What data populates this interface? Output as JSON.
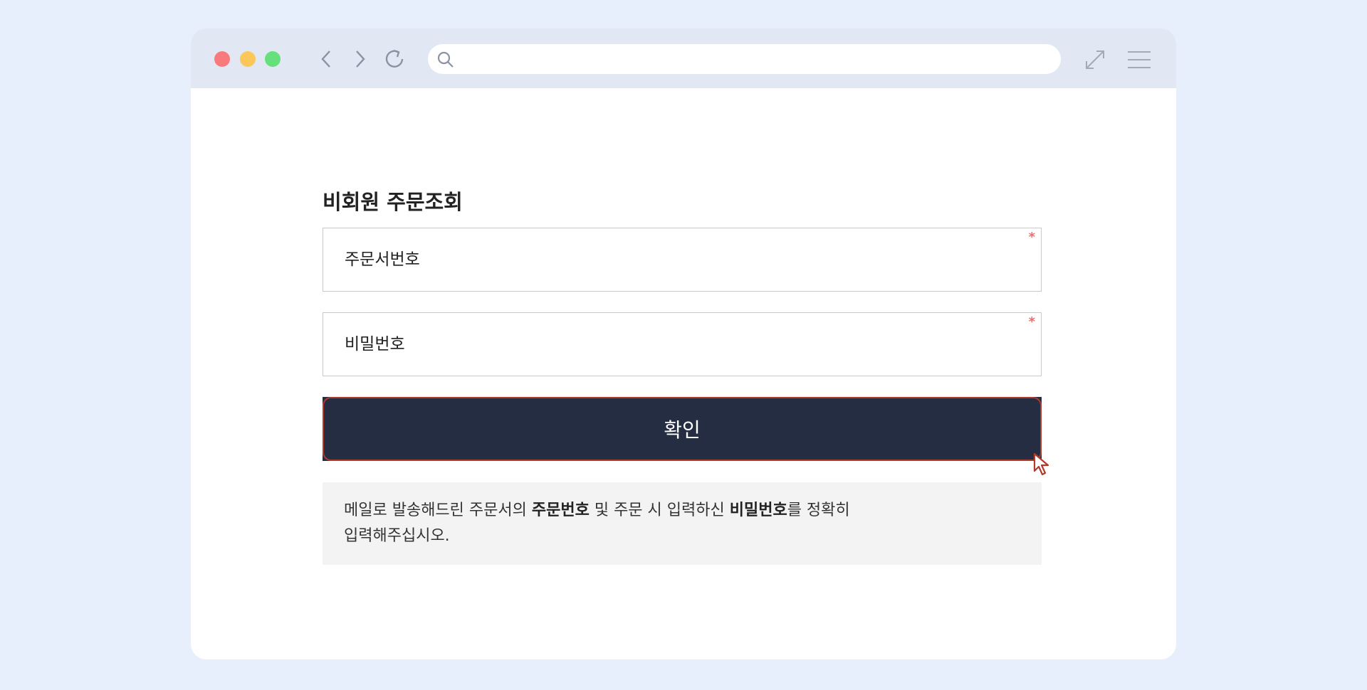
{
  "browser": {
    "address_placeholder": "",
    "icons": [
      "close-dot",
      "minimize-dot",
      "maximize-dot",
      "back-icon",
      "forward-icon",
      "reload-icon",
      "search-icon",
      "expand-icon",
      "menu-icon"
    ]
  },
  "page": {
    "title": "비회원 주문조회",
    "order_field": {
      "placeholder": "주문서번호",
      "value": "",
      "required_mark": "*"
    },
    "password_field": {
      "placeholder": "비밀번호",
      "value": "",
      "required_mark": "*"
    },
    "confirm_label": "확인",
    "notice": {
      "part1": "메일로 발송해드린 주문서의 ",
      "bold1": "주문번호",
      "part2": " 및 주문 시 입력하신 ",
      "bold2": "비밀번호",
      "part3": "를 정확히",
      "line2": "입력해주십시오."
    }
  },
  "colors": {
    "page_bg": "#e8effc",
    "toolbar_bg": "#e1e8f3",
    "button_bg": "#252d43",
    "button_border": "#b23a2b",
    "required": "#f06a6a",
    "notice_bg": "#f3f3f3"
  }
}
